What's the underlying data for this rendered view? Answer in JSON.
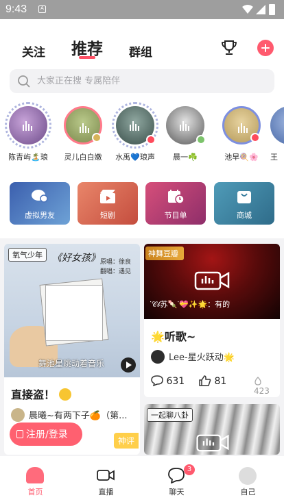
{
  "status_bar": {
    "time": "9:43",
    "sim_label": "A"
  },
  "tabs": [
    {
      "label": "关注"
    },
    {
      "label": "推荐"
    },
    {
      "label": "群组"
    }
  ],
  "search": {
    "placeholder": "大家正在搜 专属陪伴"
  },
  "hosts": [
    {
      "name": "陈青屿🏝️琅"
    },
    {
      "name": "灵儿白白嫩"
    },
    {
      "name": "水禹💙琅声"
    },
    {
      "name": "晨一☘️"
    },
    {
      "name": "池早🍭🌸"
    },
    {
      "name": "王"
    }
  ],
  "entries": [
    {
      "label": "虚拟男友"
    },
    {
      "label": "短剧"
    },
    {
      "label": "节目单"
    },
    {
      "label": "商城"
    }
  ],
  "cards": [
    {
      "tag": "氧气少年",
      "cover_title": "《好女孩》",
      "cover_side": "原唱：徐良 翻唱：遇见",
      "cover_marquee": "舞池星跳动着音乐",
      "title": "直接盗！",
      "author": "晨曦~有两下子🍊（第...",
      "badge": "神评"
    },
    {
      "tag": "神舞豆瓣",
      "cover_marquee": "ᐝ𝒞𝒷苏🍡ᐝ💝✨🌟：有的",
      "title": "🌟听歌~",
      "author": "Lee-星火跃动🌟",
      "comments": "631",
      "likes": "81",
      "views": "423"
    },
    {
      "tag": "一起聊八卦"
    }
  ],
  "login_button": "注册/登录",
  "bottom_nav": [
    {
      "label": "首页"
    },
    {
      "label": "直播"
    },
    {
      "label": "聊天",
      "badge": "3"
    },
    {
      "label": "自己"
    }
  ],
  "colors": {
    "accent": "#ff5a6e",
    "hot_badge": "#ffcf4a"
  }
}
